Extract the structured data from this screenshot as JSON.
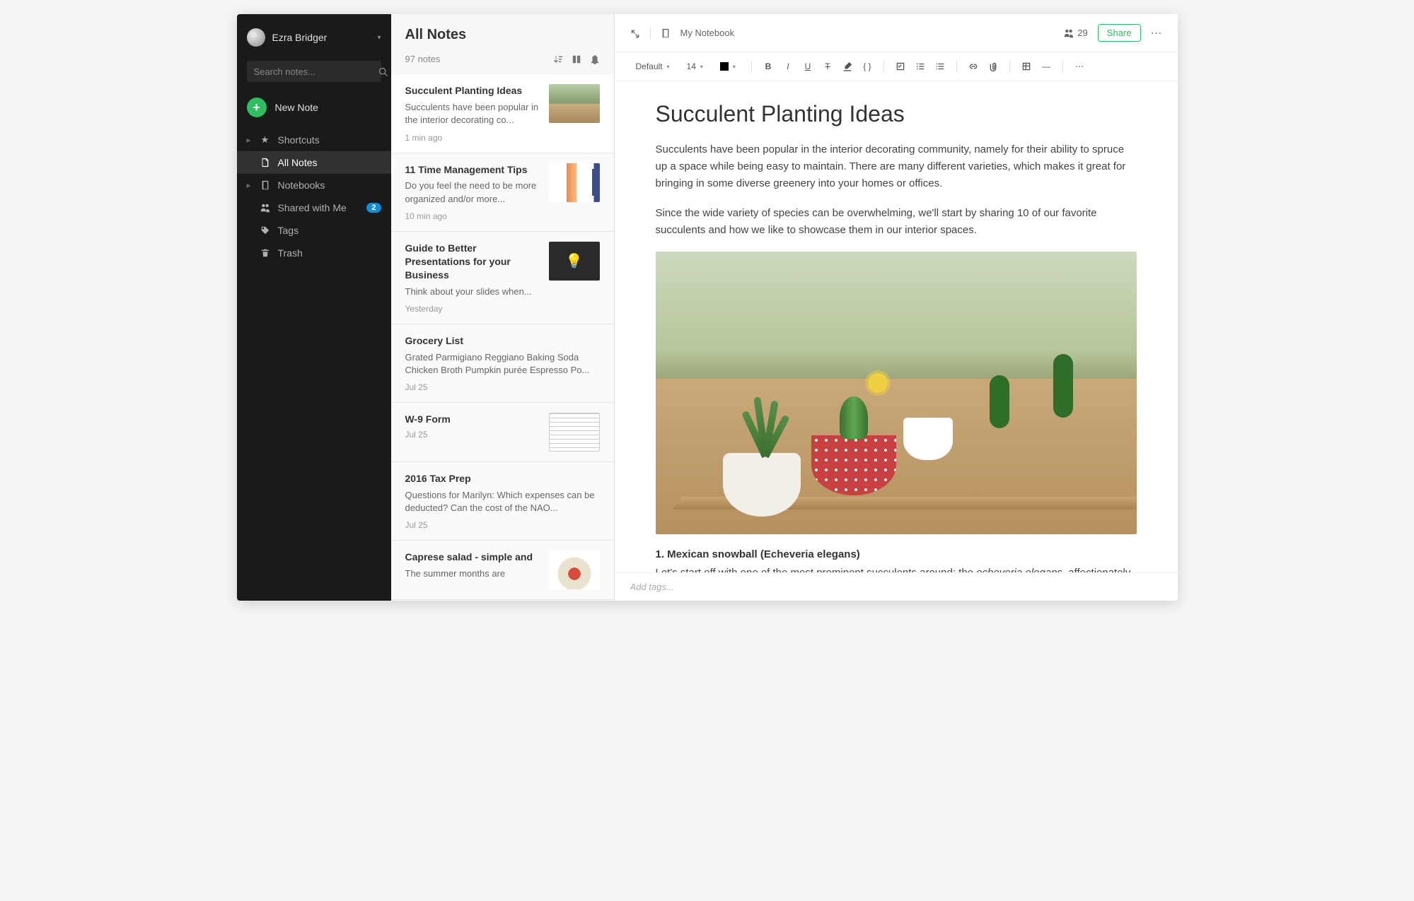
{
  "sidebar": {
    "user_name": "Ezra Bridger",
    "search_placeholder": "Search notes...",
    "new_note_label": "New Note",
    "nav": {
      "shortcuts": "Shortcuts",
      "all_notes": "All Notes",
      "notebooks": "Notebooks",
      "shared": "Shared with Me",
      "shared_badge": "2",
      "tags": "Tags",
      "trash": "Trash"
    }
  },
  "list": {
    "title": "All Notes",
    "count_label": "97 notes",
    "items": [
      {
        "title": "Succulent Planting Ideas",
        "snippet": "Succulents have been popular in the interior decorating co...",
        "time": "1 min ago",
        "thumb": "succulents"
      },
      {
        "title": "11 Time Management Tips",
        "snippet": "Do you feel the need to be more organized and/or more...",
        "time": "10 min ago",
        "thumb": "time"
      },
      {
        "title": "Guide to Better Presentations for your Business",
        "snippet": "Think about your slides when...",
        "time": "Yesterday",
        "thumb": "presentation"
      },
      {
        "title": "Grocery List",
        "snippet": "Grated Parmigiano Reggiano Baking Soda Chicken Broth Pumpkin purée Espresso Po...",
        "time": "Jul 25",
        "thumb": ""
      },
      {
        "title": "W-9 Form",
        "snippet": "",
        "time": "Jul 25",
        "thumb": "form"
      },
      {
        "title": "2016 Tax Prep",
        "snippet": "Questions for Marilyn: Which expenses can be deducted? Can the cost of the NAO...",
        "time": "Jul 25",
        "thumb": ""
      },
      {
        "title": "Caprese salad - simple and",
        "snippet": "The summer months are",
        "time": "",
        "thumb": "caprese"
      }
    ]
  },
  "editor": {
    "top": {
      "notebook": "My Notebook",
      "share_count": "29",
      "share_label": "Share"
    },
    "toolbar": {
      "font_family": "Default",
      "font_size": "14"
    },
    "doc": {
      "title": "Succulent Planting Ideas",
      "p1": "Succulents have been popular in the interior decorating community, namely for their ability to spruce up a space while being easy to maintain. There are many different varieties, which makes it great for bringing in some diverse greenery into your homes or offices.",
      "p2": "Since the wide variety of species can be overwhelming, we'll start by sharing 10 of our favorite succulents and how we like to showcase them in our interior spaces.",
      "h3": "1. Mexican snowball (Echeveria elegans)",
      "p3a": "Let's start off with one of the most prominent succulents around: the ",
      "p3b": "echeveria elegans",
      "p3c": ", affectionately"
    },
    "footer": {
      "tag_placeholder": "Add tags..."
    }
  }
}
